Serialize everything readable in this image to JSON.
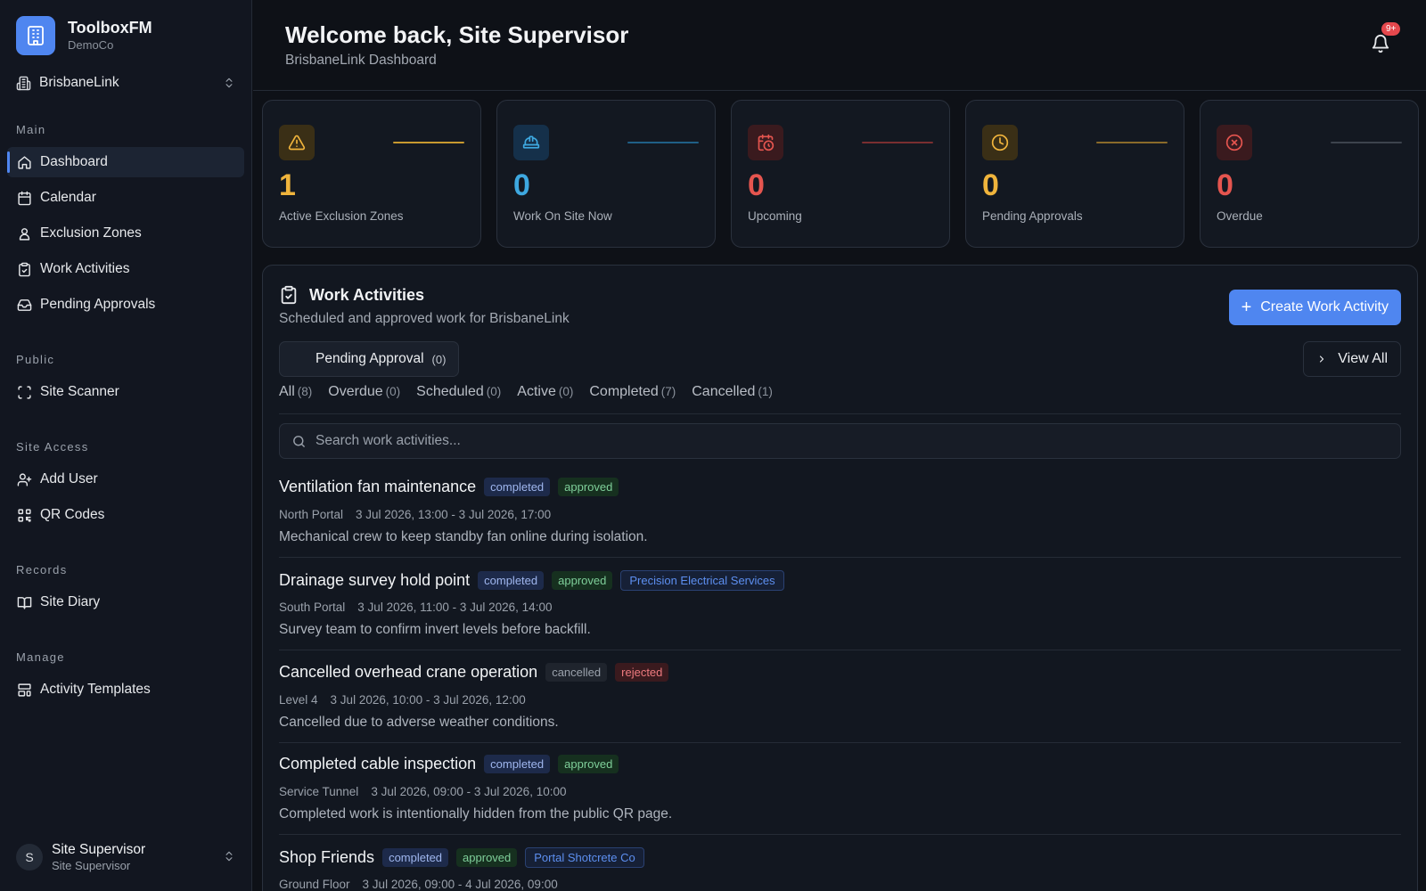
{
  "brand": {
    "name": "ToolboxFM",
    "org": "DemoCo"
  },
  "site_selector": {
    "value": "BrisbaneLink"
  },
  "nav": {
    "main_title": "Main",
    "main": [
      {
        "label": "Dashboard",
        "icon": "home-icon",
        "active": true
      },
      {
        "label": "Calendar",
        "icon": "calendar-icon"
      },
      {
        "label": "Exclusion Zones",
        "icon": "user-zone-icon"
      },
      {
        "label": "Work Activities",
        "icon": "clipboard-check-icon"
      },
      {
        "label": "Pending Approvals",
        "icon": "inbox-icon"
      }
    ],
    "public_title": "Public",
    "public": [
      {
        "label": "Site Scanner",
        "icon": "scan-icon"
      }
    ],
    "access_title": "Site Access",
    "access": [
      {
        "label": "Add User",
        "icon": "user-plus-icon"
      },
      {
        "label": "QR Codes",
        "icon": "qr-code-icon"
      }
    ],
    "records_title": "Records",
    "records": [
      {
        "label": "Site Diary",
        "icon": "book-open-icon"
      }
    ],
    "manage_title": "Manage",
    "manage": [
      {
        "label": "Activity Templates",
        "icon": "layout-template-icon"
      }
    ]
  },
  "user": {
    "initial": "S",
    "name": "Site Supervisor",
    "role": "Site Supervisor"
  },
  "header": {
    "title": "Welcome back, Site Supervisor",
    "subtitle": "BrisbaneLink Dashboard",
    "notification_badge": "9+"
  },
  "stats": [
    {
      "value": "1",
      "label": "Active Exclusion Zones",
      "icon": "warning-triangle-icon",
      "color": "#f0b43c"
    },
    {
      "value": "0",
      "label": "Work On Site Now",
      "icon": "hard-hat-icon",
      "color": "#3ea8e0"
    },
    {
      "value": "0",
      "label": "Upcoming",
      "icon": "calendar-clock-icon",
      "color": "#e5554f"
    },
    {
      "value": "0",
      "label": "Pending Approvals",
      "icon": "clock-icon",
      "color": "#f0b43c"
    },
    {
      "value": "0",
      "label": "Overdue",
      "icon": "x-circle-icon",
      "color": "#e5554f"
    }
  ],
  "work": {
    "title": "Work Activities",
    "subtitle": "Scheduled and approved work for BrisbaneLink",
    "create_label": "Create Work Activity",
    "pending_label": "Pending Approval",
    "pending_count": "(0)",
    "view_all_label": "View All",
    "filters": [
      {
        "label": "All",
        "count": "(8)"
      },
      {
        "label": "Overdue",
        "count": "(0)"
      },
      {
        "label": "Scheduled",
        "count": "(0)"
      },
      {
        "label": "Active",
        "count": "(0)"
      },
      {
        "label": "Completed",
        "count": "(7)"
      },
      {
        "label": "Cancelled",
        "count": "(1)"
      }
    ],
    "search_placeholder": "Search work activities...",
    "activities": [
      {
        "title": "Ventilation fan maintenance",
        "status": "completed",
        "approval": "approved",
        "company": "",
        "location": "North Portal",
        "datetime": "3 Jul 2026, 13:00 - 3 Jul 2026, 17:00",
        "description": "Mechanical crew to keep standby fan online during isolation."
      },
      {
        "title": "Drainage survey hold point",
        "status": "completed",
        "approval": "approved",
        "company": "Precision Electrical Services",
        "location": "South Portal",
        "datetime": "3 Jul 2026, 11:00 - 3 Jul 2026, 14:00",
        "description": "Survey team to confirm invert levels before backfill."
      },
      {
        "title": "Cancelled overhead crane operation",
        "status": "cancelled",
        "approval": "rejected",
        "company": "",
        "location": "Level 4",
        "datetime": "3 Jul 2026, 10:00 - 3 Jul 2026, 12:00",
        "description": "Cancelled due to adverse weather conditions."
      },
      {
        "title": "Completed cable inspection",
        "status": "completed",
        "approval": "approved",
        "company": "",
        "location": "Service Tunnel",
        "datetime": "3 Jul 2026, 09:00 - 3 Jul 2026, 10:00",
        "description": "Completed work is intentionally hidden from the public QR page."
      },
      {
        "title": "Shop Friends",
        "status": "completed",
        "approval": "approved",
        "company": "Portal Shotcrete Co",
        "location": "Ground Floor",
        "datetime": "3 Jul 2026, 09:00 - 4 Jul 2026, 09:00",
        "description": ""
      }
    ]
  }
}
